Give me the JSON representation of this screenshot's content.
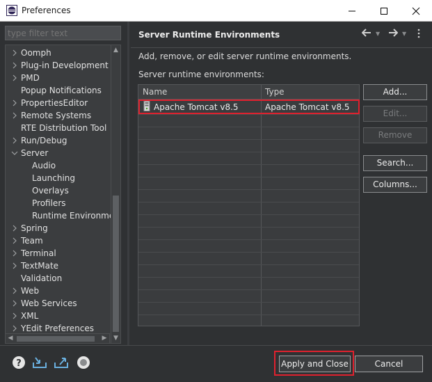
{
  "window": {
    "title": "Preferences"
  },
  "filter": {
    "placeholder": "type filter text"
  },
  "tree": {
    "items": [
      {
        "label": "Oomph",
        "expander": "collapsed",
        "indent": 0
      },
      {
        "label": "Plug-in Development",
        "expander": "collapsed",
        "indent": 0
      },
      {
        "label": "PMD",
        "expander": "collapsed",
        "indent": 0
      },
      {
        "label": "Popup Notifications",
        "expander": "none",
        "indent": 0
      },
      {
        "label": "PropertiesEditor",
        "expander": "collapsed",
        "indent": 0
      },
      {
        "label": "Remote Systems",
        "expander": "collapsed",
        "indent": 0
      },
      {
        "label": "RTE Distribution Tool",
        "expander": "none",
        "indent": 0
      },
      {
        "label": "Run/Debug",
        "expander": "collapsed",
        "indent": 0
      },
      {
        "label": "Server",
        "expander": "expanded",
        "indent": 0
      },
      {
        "label": "Audio",
        "expander": "none",
        "indent": 1
      },
      {
        "label": "Launching",
        "expander": "none",
        "indent": 1
      },
      {
        "label": "Overlays",
        "expander": "none",
        "indent": 1
      },
      {
        "label": "Profilers",
        "expander": "none",
        "indent": 1
      },
      {
        "label": "Runtime Environmen",
        "expander": "none",
        "indent": 1
      },
      {
        "label": "Spring",
        "expander": "collapsed",
        "indent": 0
      },
      {
        "label": "Team",
        "expander": "collapsed",
        "indent": 0
      },
      {
        "label": "Terminal",
        "expander": "collapsed",
        "indent": 0
      },
      {
        "label": "TextMate",
        "expander": "collapsed",
        "indent": 0
      },
      {
        "label": "Validation",
        "expander": "none",
        "indent": 0
      },
      {
        "label": "Web",
        "expander": "collapsed",
        "indent": 0
      },
      {
        "label": "Web Services",
        "expander": "collapsed",
        "indent": 0
      },
      {
        "label": "XML",
        "expander": "collapsed",
        "indent": 0
      },
      {
        "label": "YEdit Preferences",
        "expander": "collapsed",
        "indent": 0
      }
    ]
  },
  "page": {
    "title": "Server Runtime Environments",
    "description": "Add, remove, or edit server runtime environments.",
    "table_label": "Server runtime environments:",
    "columns": [
      "Name",
      "Type"
    ],
    "rows": [
      {
        "name": "Apache Tomcat v8.5",
        "type": "Apache Tomcat v8.5",
        "checked": true
      }
    ]
  },
  "buttons": {
    "add": "Add...",
    "edit": "Edit...",
    "remove": "Remove",
    "search": "Search...",
    "columns": "Columns...",
    "apply_close": "Apply and Close",
    "cancel": "Cancel"
  },
  "colors": {
    "highlight": "#e0212e",
    "background": "#2f3133"
  }
}
